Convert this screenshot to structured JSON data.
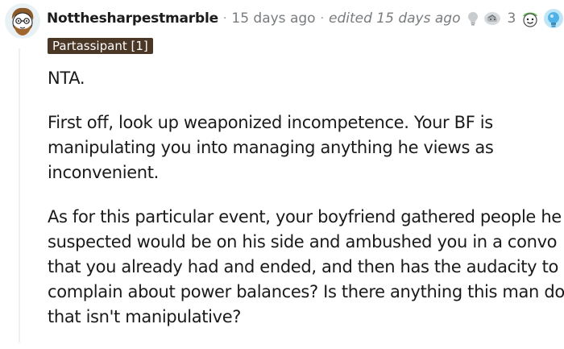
{
  "comment": {
    "username": "Notthesharpestmarble",
    "separator": "·",
    "timestamp": "15 days ago",
    "edited": "edited 15 days ago",
    "flair": "Partassipant [1]",
    "awards": {
      "count": "3",
      "icons": [
        "helpful-lightbulb-icon",
        "silver-award-icon",
        "wholesome-face-icon",
        "lightbulb-glow-icon"
      ]
    },
    "paragraphs": [
      [
        "NTA."
      ],
      [
        "First off, look up weaponized incompetence. Your BF is",
        "manipulating you into managing anything he views as",
        "inconvenient."
      ],
      [
        "As for this particular event, your boyfriend gathered people he",
        "suspected would be on his side and ambushed you in a convo",
        "that you already had and ended, and then has the audacity to",
        "complain about power balances? Is there anything this man does",
        "that isn't manipulative?"
      ]
    ]
  },
  "colors": {
    "flair_bg": "#4b3726",
    "meta_gray": "#787c7e",
    "thread_line": "#edeff1",
    "text": "#1a1a1b"
  }
}
